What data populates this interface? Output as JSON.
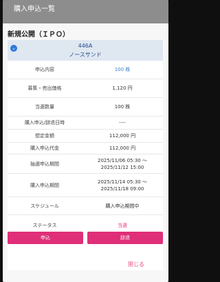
{
  "page": {
    "title": "購入申込一覧",
    "section_title": "新規公開（ＩＰＯ）"
  },
  "ipo": {
    "code": "446A",
    "name": "ノースサンド"
  },
  "rows": {
    "application": {
      "label": "申込内容",
      "value": "100 株"
    },
    "offer_price": {
      "label": "募集・売出価格",
      "value": "1,120 円"
    },
    "allotted": {
      "label": "当選数量",
      "value": "100 株"
    },
    "decline_date": {
      "label": "購入申込/辞退日時",
      "value": "----"
    },
    "estimated_amount": {
      "label": "想定金額",
      "value": "112,000 円"
    },
    "purchase_amount": {
      "label": "購入申込代金",
      "value": "112,000 円"
    },
    "lottery_period": {
      "label": "抽選申込期間",
      "from": "2025/11/06 05:30 ～",
      "to": "2025/11/12 15:00"
    },
    "purchase_period": {
      "label": "購入申込期間",
      "from": "2025/11/14 05:30 ～",
      "to": "2025/11/18 09:00"
    },
    "schedule": {
      "label": "スケジュール",
      "value": "購入申込期間中"
    },
    "status": {
      "label": "ステータス",
      "value": "当選"
    }
  },
  "actions": {
    "apply_label": "申込",
    "decline_label": "辞退",
    "close_label": "閉じる"
  },
  "colors": {
    "accent": "#df2f78",
    "link_blue": "#3a7bd5",
    "header_band": "#dfe7f1"
  }
}
